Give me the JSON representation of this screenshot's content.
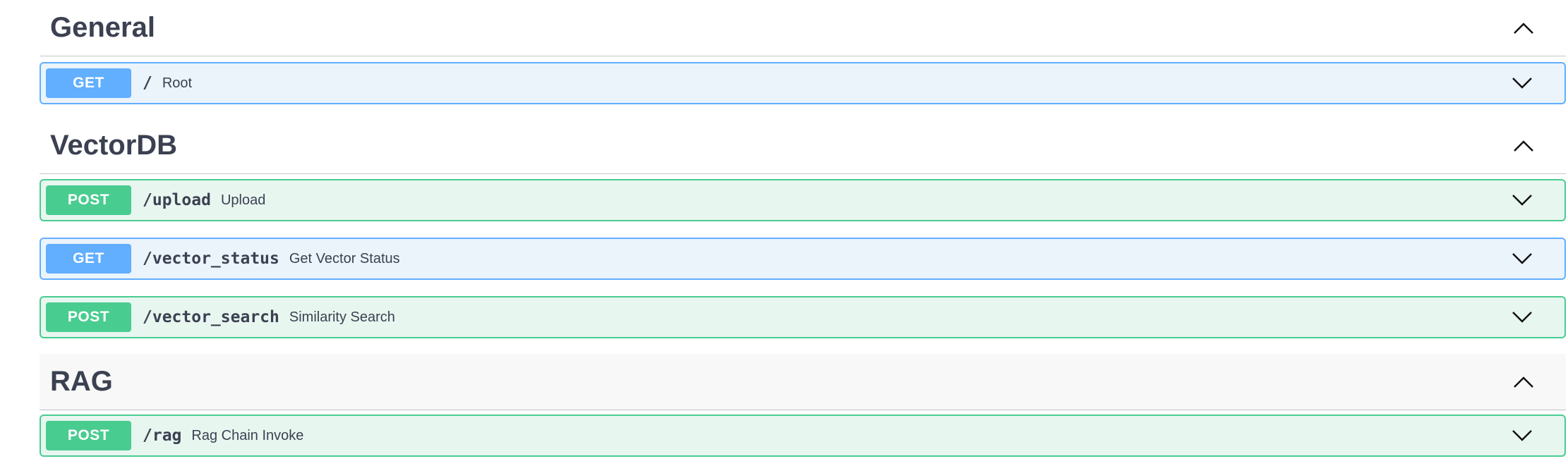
{
  "sections": [
    {
      "title": "General",
      "operations": [
        {
          "method": "GET",
          "path": "/",
          "summary": "Root"
        }
      ]
    },
    {
      "title": "VectorDB",
      "operations": [
        {
          "method": "POST",
          "path": "/upload",
          "summary": "Upload"
        },
        {
          "method": "GET",
          "path": "/vector_status",
          "summary": "Get Vector Status"
        },
        {
          "method": "POST",
          "path": "/vector_search",
          "summary": "Similarity Search"
        }
      ]
    },
    {
      "title": "RAG",
      "operations": [
        {
          "method": "POST",
          "path": "/rag",
          "summary": "Rag Chain Invoke"
        }
      ]
    }
  ],
  "icons": {
    "collapse": "chevron-up-icon",
    "expand": "chevron-down-icon"
  },
  "colors": {
    "get": "#61affe",
    "post": "#49cc90",
    "get_bg": "#ebf3fb",
    "post_bg": "#e8f6f0"
  }
}
